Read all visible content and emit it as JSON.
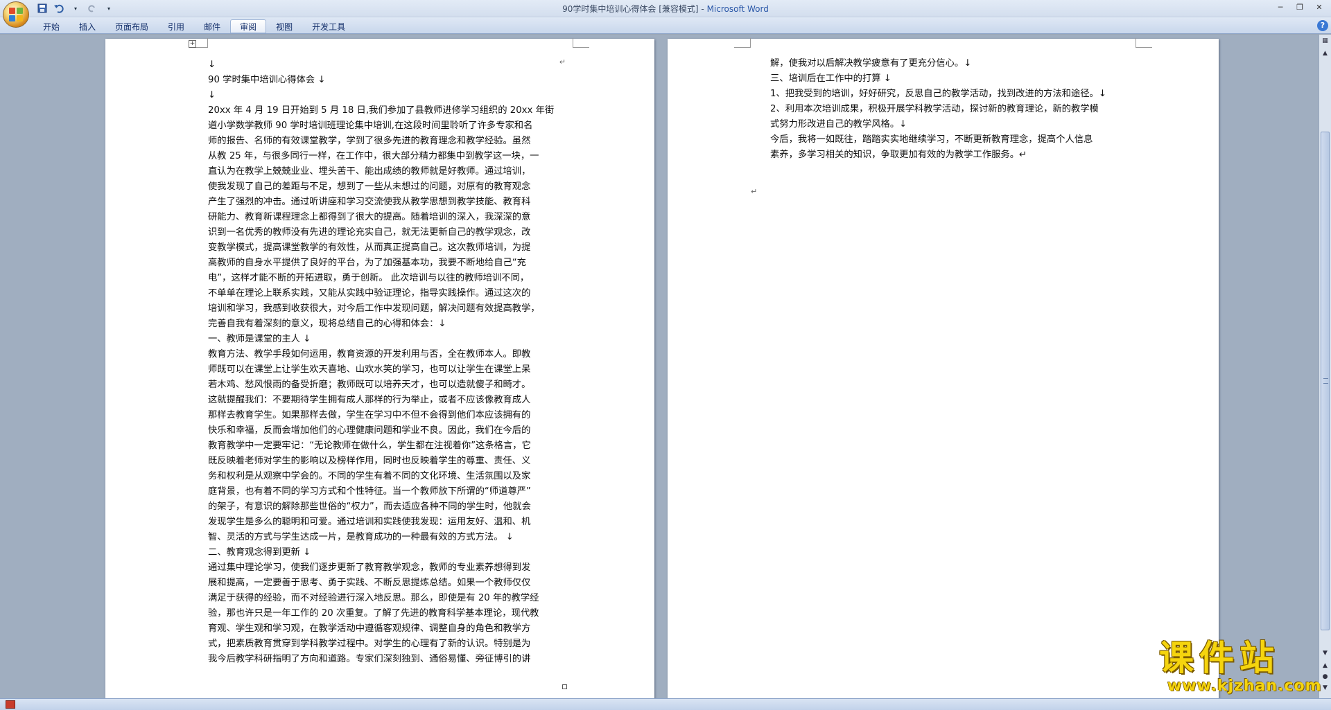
{
  "window": {
    "title_doc": "90学时集中培训心得体会 [兼容模式] - ",
    "title_app": "Microsoft Word"
  },
  "ribbon": {
    "tabs": [
      "开始",
      "插入",
      "页面布局",
      "引用",
      "邮件",
      "审阅",
      "视图",
      "开发工具"
    ],
    "active_tab": "审阅"
  },
  "document": {
    "page1_lines": [
      "↓",
      "90 学时集中培训心得体会 ↓",
      "↓",
      "20xx 年 4 月 19 日开始到 5 月 18 日,我们参加了县教师进修学习组织的 20xx 年街",
      "道小学数学教师 90  学时培训班理论集中培训,在这段时间里聆听了许多专家和名",
      "师的报告、名师的有效课堂教学，学到了很多先进的教育理念和教学经验。虽然",
      "从教 25 年，与很多同行一样，在工作中，很大部分精力都集中到教学这一块，一",
      "直认为在教学上兢兢业业、埋头苦干、能出成绩的教师就是好教师。通过培训，",
      "使我发现了自己的差距与不足，想到了一些从未想过的问题，对原有的教育观念",
      "产生了强烈的冲击。通过听讲座和学习交流使我从教学思想到教学技能、教育科",
      "研能力、教育新课程理念上都得到了很大的提高。随着培训的深入，我深深的意",
      "识到一名优秀的教师没有先进的理论充实自己，就无法更新自己的教学观念，改",
      "变教学模式，提高课堂教学的有效性，从而真正提高自己。这次教师培训，为提",
      "高教师的自身水平提供了良好的平台，为了加强基本功，我要不断地给自己“充",
      "电”，这样才能不断的开拓进取，勇于创新。  此次培训与以往的教师培训不同，",
      "不单单在理论上联系实践，又能从实践中验证理论，指导实践操作。通过这次的",
      "培训和学习，我感到收获很大，对今后工作中发现问题，解决问题有效提高教学，",
      "完善自我有着深刻的意义，现将总结自己的心得和体会：↓",
      "一、教师是课堂的主人 ↓",
      "教育方法、教学手段如何运用，教育资源的开发利用与否，全在教师本人。即教",
      "师既可以在课堂上让学生欢天喜地、山欢水笑的学习，也可以让学生在课堂上呆",
      "若木鸡、愁风恨雨的备受折磨；教师既可以培养天才，也可以造就傻子和畸才。",
      "这就提醒我们：不要期待学生拥有成人那样的行为举止，或者不应该像教育成人",
      "那样去教育学生。如果那样去做，学生在学习中不但不会得到他们本应该拥有的",
      "快乐和幸福，反而会增加他们的心理健康问题和学业不良。因此，我们在今后的",
      "教育教学中一定要牢记：“无论教师在做什么，学生都在注视着你”这条格言，它",
      "既反映着老师对学生的影响以及榜样作用，同时也反映着学生的尊重、责任、义",
      "务和权利是从观察中学会的。不同的学生有着不同的文化环境、生活氛围以及家",
      "庭背景，也有着不同的学习方式和个性特征。当一个教师放下所谓的“师道尊严”",
      "的架子，有意识的解除那些世俗的“权力”，而去适应各种不同的学生时，他就会",
      "发现学生是多么的聪明和可爱。通过培训和实践使我发现：运用友好、温和、机",
      "智、灵活的方式与学生达成一片，是教育成功的一种最有效的方式方法。 ↓",
      "二、教育观念得到更新 ↓",
      "通过集中理论学习，使我们逐步更新了教育教学观念，教师的专业素养想得到发",
      "展和提高，一定要善于思考、勇于实践、不断反思提炼总结。如果一个教师仅仅",
      "满足于获得的经验，而不对经验进行深入地反思。那么，即使是有 20 年的教学经",
      "验，那也许只是一年工作的 20 次重复。了解了先进的教育科学基本理论，现代教",
      "育观、学生观和学习观，在教学活动中遵循客观规律、调整自身的角色和教学方",
      "式，把素质教育贯穿到学科教学过程中。对学生的心理有了新的认识。特别是为",
      "我今后教学科研指明了方向和道路。专家们深刻独到、通俗易懂、旁征博引的讲"
    ],
    "page2_lines": [
      "解，使我对以后解决教学疲意有了更充分信心。↓",
      "三、培训后在工作中的打算 ↓",
      "1、把我受到的培训，好好研究，反思自己的教学活动，找到改进的方法和途径。↓",
      "2、利用本次培训成果，积极开展学科教学活动，探讨新的教育理论，新的教学模",
      "式努力形改进自己的教学风格。↓",
      "今后，我将一如既往，踏踏实实地继续学习，不断更新教育理念，提高个人信息",
      "素养，多学习相关的知识，争取更加有效的为教学工作服务。↵"
    ],
    "page1_return_mark": "↵",
    "page2_end_mark": "↵"
  },
  "watermark": {
    "big": "课件站",
    "small": "www.kjzhan.com"
  },
  "colors": {
    "workspace": "#a0aec0",
    "ribbon": "#c9d7ec",
    "watermark": "#f5d40e"
  }
}
